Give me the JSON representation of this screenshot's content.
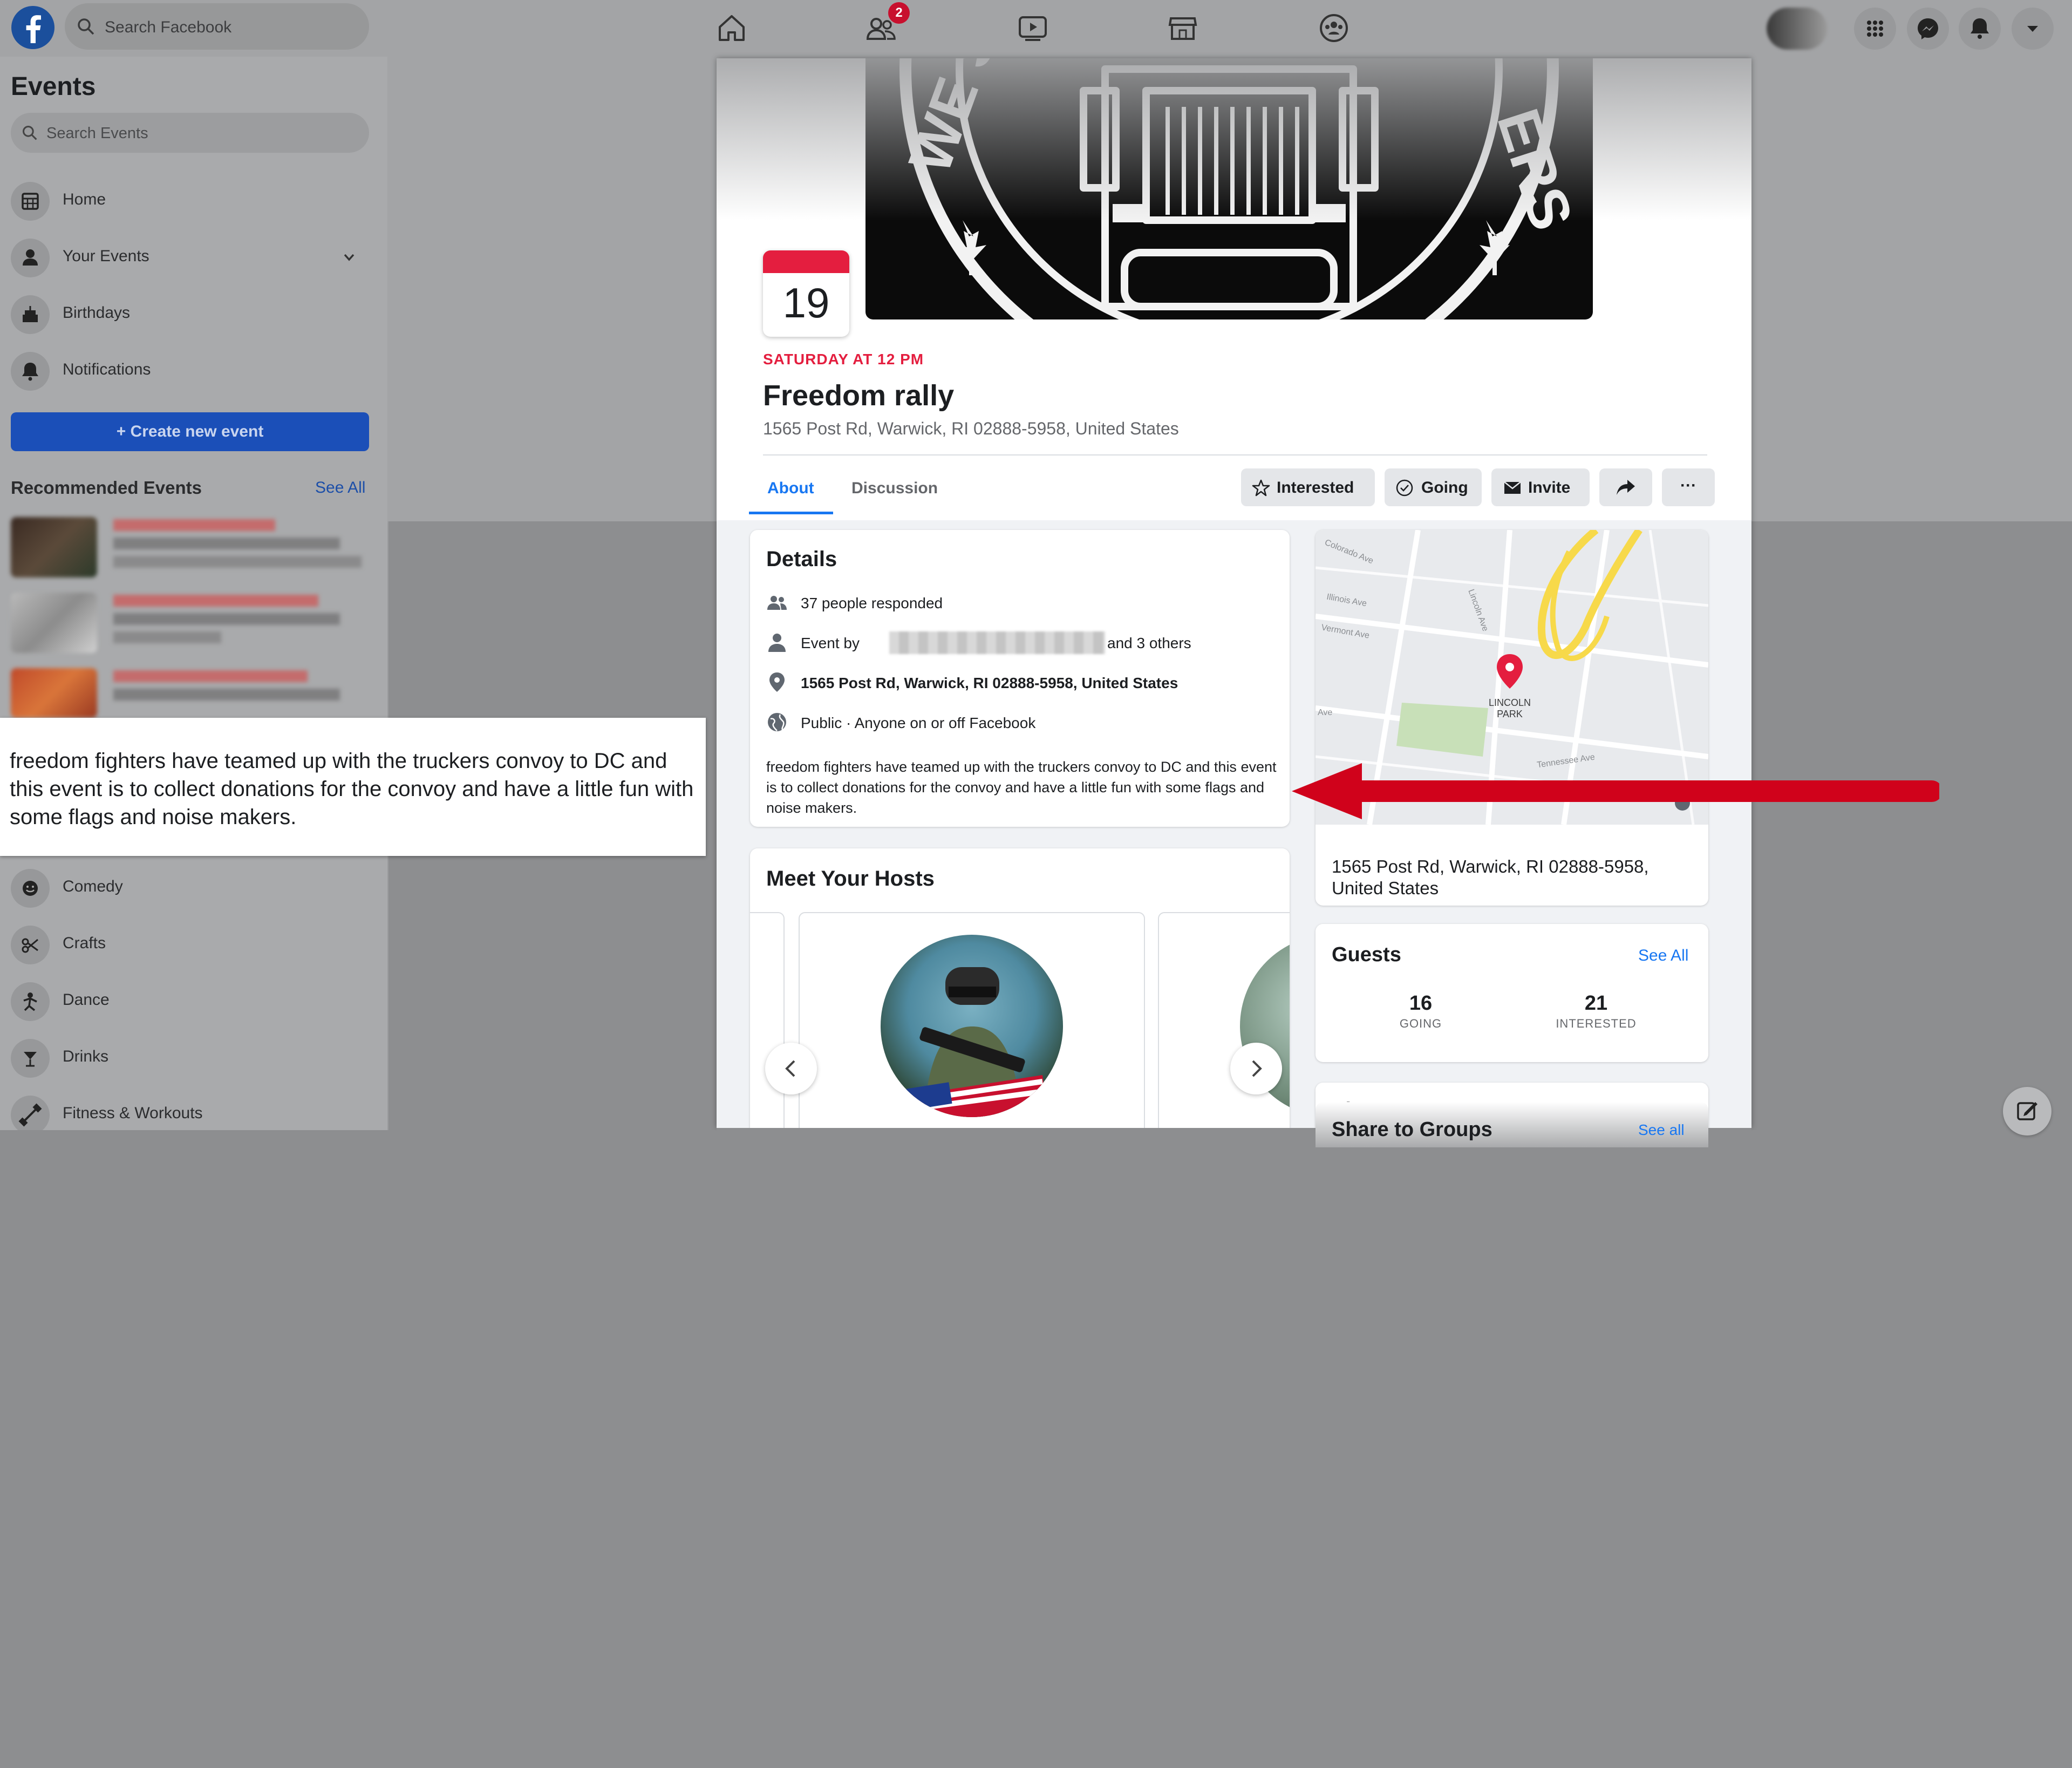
{
  "topbar": {
    "search_placeholder": "Search Facebook",
    "friends_badge": "2"
  },
  "sidebar": {
    "title": "Events",
    "search_placeholder": "Search Events",
    "items": [
      {
        "label": "Home",
        "icon": "calendar-grid-icon"
      },
      {
        "label": "Your Events",
        "icon": "person-icon"
      },
      {
        "label": "Birthdays",
        "icon": "cake-icon"
      },
      {
        "label": "Notifications",
        "icon": "bell-icon"
      }
    ],
    "create_label": "+ Create new event",
    "recommended_title": "Recommended Events",
    "see_all": "See All",
    "categories": [
      {
        "label": "Comedy",
        "icon": "smile-icon"
      },
      {
        "label": "Crafts",
        "icon": "scissors-icon"
      },
      {
        "label": "Dance",
        "icon": "dance-icon"
      },
      {
        "label": "Drinks",
        "icon": "cocktail-icon"
      },
      {
        "label": "Fitness & Workouts",
        "icon": "dumbbell-icon"
      }
    ]
  },
  "callout": {
    "text": "freedom fighters have teamed up with the truckers convoy to DC and this event is to collect donations for the convoy and have a little fun with some flags and noise makers."
  },
  "event": {
    "day": "19",
    "when": "SATURDAY AT 12 PM",
    "title": "Freedom rally",
    "address": "1565 Post Rd, Warwick, RI 02888-5958, United States",
    "tabs": [
      "About",
      "Discussion"
    ],
    "buttons": {
      "interested": "Interested",
      "going": "Going",
      "invite": "Invite",
      "more": "···"
    },
    "details": {
      "title": "Details",
      "responded": "37 people responded",
      "event_by": "Event by",
      "and_others": "and 3 others",
      "address": "1565 Post Rd, Warwick, RI 02888-5958, United States",
      "privacy": "Public · Anyone on or off Facebook",
      "description": "freedom fighters have teamed up with the truckers convoy to DC and this event is to collect donations for the convoy and have a little fun with some flags and noise makers."
    },
    "hosts_title": "Meet Your Hosts",
    "map": {
      "labels": [
        "Colorado Ave",
        "Illinois Ave",
        "Vermont Ave",
        "Lincoln Ave",
        "Tennessee Ave",
        "Ave",
        "LINCOLN PARK"
      ],
      "address": "1565 Post Rd, Warwick, RI 02888-5958, United States"
    },
    "guests": {
      "title": "Guests",
      "see_all": "See All",
      "going_count": "16",
      "going_label": "GOING",
      "interested_count": "21",
      "interested_label": "INTERESTED"
    },
    "share": {
      "title": "Share to Groups",
      "see_all": "See all"
    }
  },
  "colors": {
    "accent": "#1877f2",
    "date_red": "#e41e3f",
    "arrow_red": "#d0021b",
    "create_btn": "#1b4fb8"
  }
}
